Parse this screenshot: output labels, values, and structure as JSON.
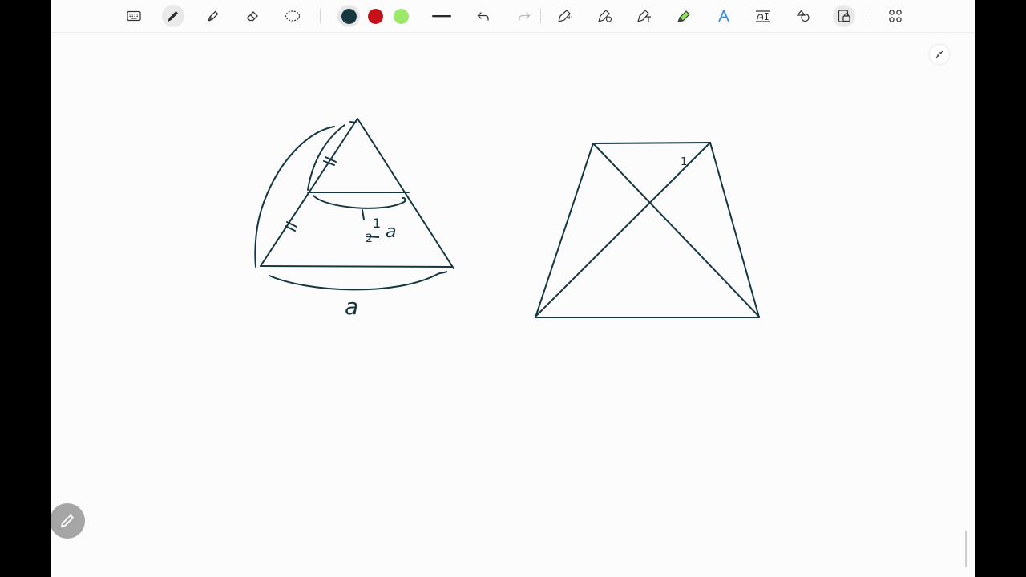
{
  "toolbar": {
    "tools": [
      {
        "name": "keyboard-icon"
      },
      {
        "name": "pen-icon",
        "active": true
      },
      {
        "name": "highlighter-icon"
      },
      {
        "name": "eraser-icon"
      },
      {
        "name": "lasso-icon"
      }
    ],
    "colors": [
      {
        "name": "color-dark-teal",
        "hex": "#163640",
        "selected": true
      },
      {
        "name": "color-red",
        "hex": "#c8101a",
        "selected": false
      },
      {
        "name": "color-light-green",
        "hex": "#9be86a",
        "selected": false
      }
    ],
    "actions": [
      {
        "name": "stroke-width-icon"
      },
      {
        "name": "undo-icon"
      },
      {
        "name": "redo-icon",
        "disabled": true
      },
      {
        "name": "shape-pen-icon"
      },
      {
        "name": "pen-settings-icon"
      },
      {
        "name": "text-pen-icon"
      },
      {
        "name": "green-highlighter-icon"
      },
      {
        "name": "text-style-icon"
      },
      {
        "name": "text-format-icon"
      },
      {
        "name": "shapes-icon"
      },
      {
        "name": "lock-icon",
        "active": true
      },
      {
        "name": "apps-grid-icon"
      }
    ]
  },
  "canvas": {
    "ink_color": "#163640",
    "labels": {
      "half_numerator": "1",
      "half_denominator": "2",
      "half_var": "a",
      "base_label": "a",
      "trapezoid_mark": "1"
    }
  }
}
